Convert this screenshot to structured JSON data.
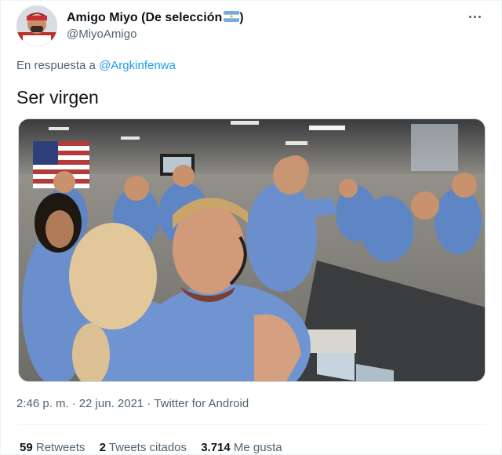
{
  "author": {
    "display_name": "Amigo Miyo (De selección",
    "display_name_suffix": ")",
    "handle": "@MiyoAmigo",
    "avatar_icon": "avatar-photo",
    "flag_icon": "argentina-flag-icon"
  },
  "reply": {
    "prefix": "En respuesta a ",
    "mention": "@Argkinfenwa"
  },
  "tweet": {
    "text": "Ser virgen"
  },
  "media": {
    "description_icon": "photo"
  },
  "meta": {
    "time": "2:46 p. m.",
    "separator": "·",
    "date": "22 jun. 2021",
    "source": "Twitter for Android"
  },
  "stats": {
    "retweets_count": "59",
    "retweets_label": "Retweets",
    "quotes_count": "2",
    "quotes_label": "Tweets citados",
    "likes_count": "3.714",
    "likes_label": "Me gusta"
  },
  "colors": {
    "link": "#1d9bf0",
    "secondary_text": "#536471",
    "primary_text": "#0f1419"
  }
}
